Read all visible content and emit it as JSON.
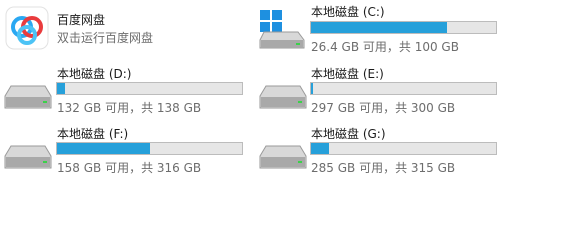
{
  "app": {
    "title": "百度网盘",
    "subtitle": "双击运行百度网盘"
  },
  "drives": [
    {
      "id": "c",
      "label": "本地磁盘 (C:)",
      "space_text": "26.4 GB 可用，共 100 GB",
      "used_fraction": 0.736,
      "icon": "windows-drive-icon"
    },
    {
      "id": "d",
      "label": "本地磁盘 (D:)",
      "space_text": "132 GB 可用，共 138 GB",
      "used_fraction": 0.043,
      "icon": "hard-drive-icon"
    },
    {
      "id": "e",
      "label": "本地磁盘 (E:)",
      "space_text": "297 GB 可用，共 300 GB",
      "used_fraction": 0.01,
      "icon": "hard-drive-icon"
    },
    {
      "id": "f",
      "label": "本地磁盘 (F:)",
      "space_text": "158 GB 可用，共 316 GB",
      "used_fraction": 0.5,
      "icon": "hard-drive-icon"
    },
    {
      "id": "g",
      "label": "本地磁盘 (G:)",
      "space_text": "285 GB 可用，共 315 GB",
      "used_fraction": 0.095,
      "icon": "hard-drive-icon"
    }
  ],
  "colors": {
    "bar_fill": "#26a0da",
    "bar_track": "#e6e6e6",
    "secondary_text": "#6d6d6d"
  }
}
